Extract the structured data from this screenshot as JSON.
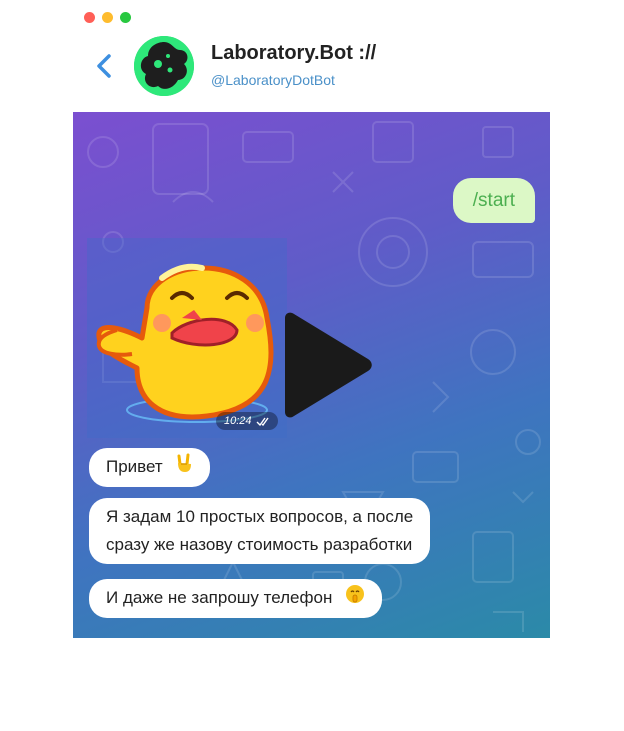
{
  "window": {
    "controls": [
      "#ff5f57",
      "#febc2e",
      "#28c840"
    ]
  },
  "header": {
    "back_icon": "chevron-left-icon",
    "name": "Laboratory.Bot ://",
    "handle": "@LaboratoryDotBot"
  },
  "chat": {
    "outgoing": {
      "text": "/start"
    },
    "sticker": {
      "time": "10:24",
      "status_icon": "double-check-icon"
    },
    "messages": [
      {
        "text": "Привет",
        "emoji": "rock-on-hand-icon"
      },
      {
        "line1": "Я задам 10 простых вопросов, а после",
        "line2": "сразу же назову стоимость разработки"
      },
      {
        "text": "И даже не запрошу телефон",
        "emoji": "shushing-face-icon"
      }
    ]
  }
}
